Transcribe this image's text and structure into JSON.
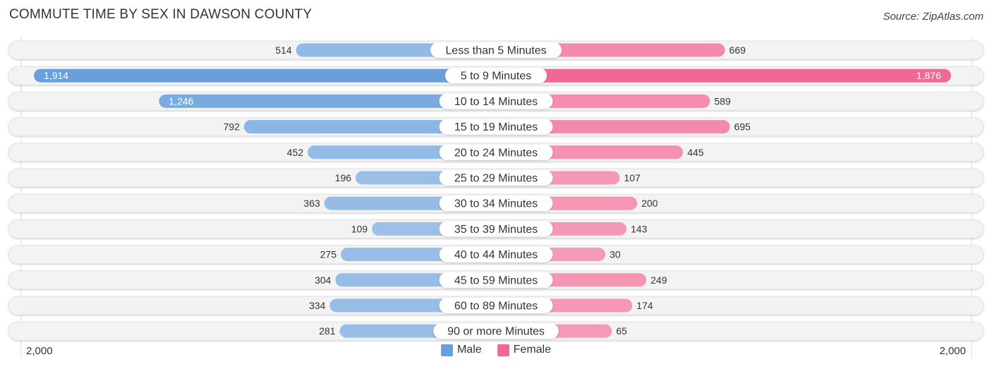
{
  "title": "COMMUTE TIME BY SEX IN DAWSON COUNTY",
  "source": "Source: ZipAtlas.com",
  "colors": {
    "male": "#6a9fdb",
    "male_light": "#9fc2e8",
    "female": "#f06894",
    "female_light": "#f59bb8",
    "row_bg": "#f3f3f3"
  },
  "legend": [
    {
      "name": "Male",
      "color": "#6a9fdb"
    },
    {
      "name": "Female",
      "color": "#f06894"
    }
  ],
  "axis": {
    "left_label": "2,000",
    "right_label": "2,000"
  },
  "chart_data": {
    "type": "bar",
    "orientation": "horizontal-diverging",
    "title": "COMMUTE TIME BY SEX IN DAWSON COUNTY",
    "categories": [
      "Less than 5 Minutes",
      "5 to 9 Minutes",
      "10 to 14 Minutes",
      "15 to 19 Minutes",
      "20 to 24 Minutes",
      "25 to 29 Minutes",
      "30 to 34 Minutes",
      "35 to 39 Minutes",
      "40 to 44 Minutes",
      "45 to 59 Minutes",
      "60 to 89 Minutes",
      "90 or more Minutes"
    ],
    "series": [
      {
        "name": "Male",
        "side": "left",
        "values": [
          514,
          1914,
          1246,
          792,
          452,
          196,
          363,
          109,
          275,
          304,
          334,
          281
        ],
        "labels": [
          "514",
          "1,914",
          "1,246",
          "792",
          "452",
          "196",
          "363",
          "109",
          "275",
          "304",
          "334",
          "281"
        ]
      },
      {
        "name": "Female",
        "side": "right",
        "values": [
          669,
          1876,
          589,
          695,
          445,
          107,
          200,
          143,
          30,
          249,
          174,
          65
        ],
        "labels": [
          "669",
          "1,876",
          "589",
          "695",
          "445",
          "107",
          "200",
          "143",
          "30",
          "249",
          "174",
          "65"
        ]
      }
    ],
    "xlim": [
      -2000,
      2000
    ],
    "xtick_labels": [
      "2,000",
      "2,000"
    ],
    "legend_position": "bottom-center",
    "grid": false
  }
}
